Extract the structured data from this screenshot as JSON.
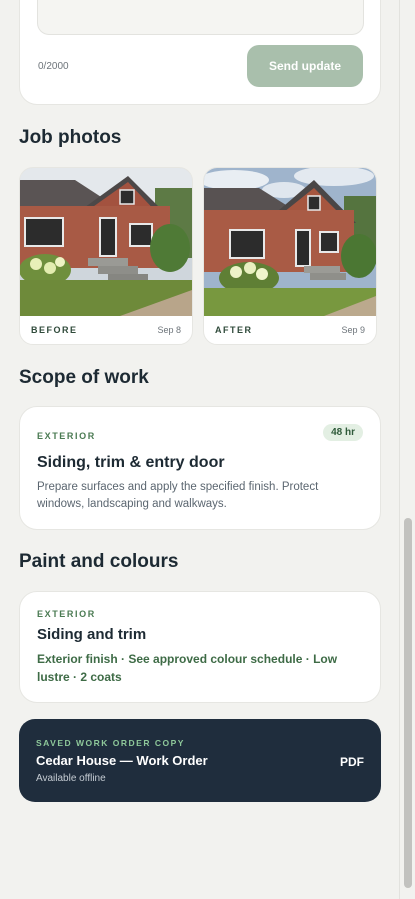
{
  "update_form": {
    "char_count": "0/2000",
    "send_label": "Send update"
  },
  "job_photos": {
    "title": "Job photos",
    "photos": [
      {
        "label": "BEFORE",
        "date": "Sep 8"
      },
      {
        "label": "AFTER",
        "date": "Sep 9"
      }
    ]
  },
  "scope": {
    "title": "Scope of work",
    "category": "EXTERIOR",
    "hours": "48 hr",
    "item_title": "Siding, trim & entry door",
    "description": "Prepare surfaces and apply the specified finish. Protect windows, landscaping and walkways."
  },
  "paint": {
    "title": "Paint and colours",
    "category": "EXTERIOR",
    "item_title": "Siding and trim",
    "detail": "Exterior finish · See approved colour schedule · Low lustre · 2 coats"
  },
  "saved_copy": {
    "eyebrow": "SAVED WORK ORDER COPY",
    "title": "Cedar House — Work Order",
    "status": "Available offline",
    "format": "PDF"
  },
  "colors": {
    "accent_green": "#a9bfac",
    "dark_card": "#1f2d3d",
    "badge_bg": "#e3efe3"
  }
}
